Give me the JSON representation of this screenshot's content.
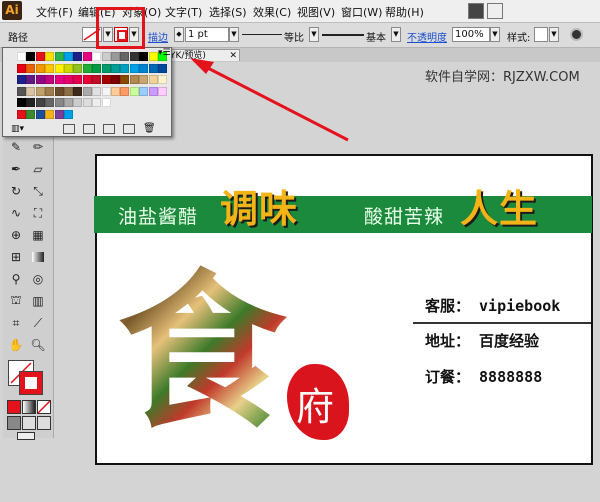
{
  "app": {
    "logo": "Ai"
  },
  "menu": {
    "items": [
      "文件(F)",
      "编辑(E)",
      "对象(O)",
      "文字(T)",
      "选择(S)",
      "效果(C)",
      "视图(V)",
      "窗口(W)",
      "帮助(H)"
    ]
  },
  "control_bar": {
    "selection_label": "路径",
    "stroke_label": "描边",
    "stroke_weight": "1 pt",
    "profile_label": "等比",
    "brush_label": "基本",
    "opacity_label": "不透明度",
    "opacity_value": "100%",
    "style_label": "样式:"
  },
  "tab": {
    "title": "YK/预览)"
  },
  "watermark": "软件自学网：RJZXW.COM",
  "card": {
    "slogan_left_small": "油盐酱醋",
    "slogan_left_big": "调味",
    "slogan_right_small": "酸甜苦辣",
    "slogan_right_big": "人生",
    "logo_char": "食",
    "seal_char": "府",
    "service_line": "客服： vipiebook",
    "address_line": "地址： 百度经验",
    "order_line": "订餐： 8888888"
  },
  "colors": {
    "highlight": "#e4121a",
    "band": "#1b8a3c",
    "slogan_big": "#f4b316",
    "seal": "#d9141c"
  }
}
